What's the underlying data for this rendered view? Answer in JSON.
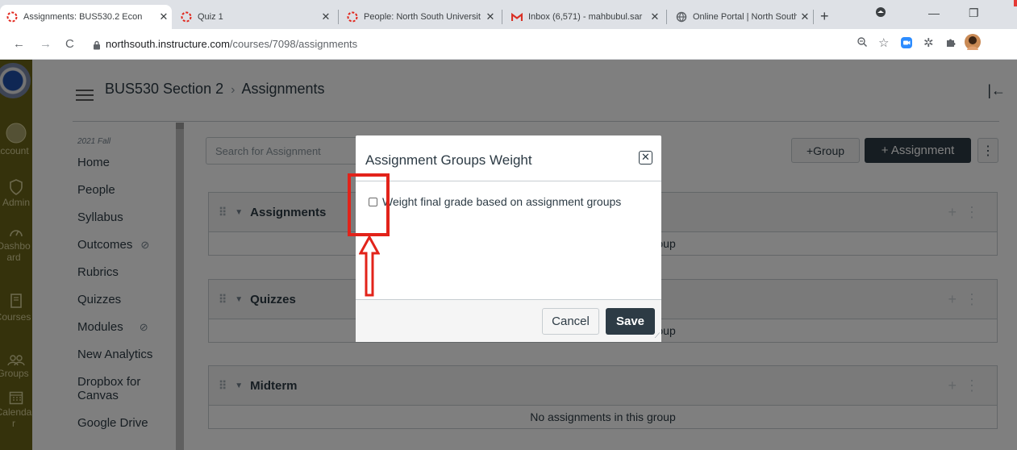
{
  "browser": {
    "tabs": [
      {
        "label": "Assignments: BUS530.2 Econ",
        "icon": "canvas-icon",
        "active": true
      },
      {
        "label": "Quiz 1",
        "icon": "canvas-icon",
        "active": false
      },
      {
        "label": "People: North South Universit",
        "icon": "canvas-icon",
        "active": false
      },
      {
        "label": "Inbox (6,571) - mahbubul.sar",
        "icon": "gmail-icon",
        "active": false
      },
      {
        "label": "Online Portal | North South U",
        "icon": "globe-icon",
        "active": false
      }
    ],
    "url_host": "northsouth.instructure.com",
    "url_path": "/courses/7098/assignments"
  },
  "global_nav": {
    "items": [
      {
        "label": "Account",
        "icon": "user-icon"
      },
      {
        "label": "Admin",
        "icon": "shield-icon"
      },
      {
        "label": "Dashboard",
        "icon": "dashboard-icon"
      },
      {
        "label": "Courses",
        "icon": "book-icon"
      },
      {
        "label": "Groups",
        "icon": "groups-icon"
      },
      {
        "label": "Calendar",
        "icon": "calendar-icon"
      }
    ]
  },
  "header": {
    "course": "BUS530 Section 2",
    "separator": "›",
    "page": "Assignments"
  },
  "course_nav": {
    "term": "2021 Fall",
    "items": [
      {
        "label": "Home",
        "hidden": false
      },
      {
        "label": "People",
        "hidden": false
      },
      {
        "label": "Syllabus",
        "hidden": false
      },
      {
        "label": "Outcomes",
        "hidden": true
      },
      {
        "label": "Rubrics",
        "hidden": false
      },
      {
        "label": "Quizzes",
        "hidden": false
      },
      {
        "label": "Modules",
        "hidden": true
      },
      {
        "label": "New Analytics",
        "hidden": false
      },
      {
        "label": "Dropbox for Canvas",
        "hidden": false
      },
      {
        "label": "Google Drive",
        "hidden": false
      }
    ]
  },
  "toolbar": {
    "search_placeholder": "Search for Assignment",
    "group_button": "+Group",
    "assignment_button": "+ Assignment"
  },
  "groups": [
    {
      "name": "Assignments",
      "empty_text": "No assignments in this group"
    },
    {
      "name": "Quizzes",
      "empty_text": "No assignments in this group"
    },
    {
      "name": "Midterm",
      "empty_text": "No assignments in this group"
    }
  ],
  "modal": {
    "title": "Assignment Groups Weight",
    "checkbox_label": "Weight final grade based on assignment groups",
    "checked": false,
    "cancel": "Cancel",
    "save": "Save"
  },
  "colors": {
    "global_nav_bg": "#6b6419",
    "primary_button": "#2d3b45",
    "annotation": "#e2231a"
  }
}
